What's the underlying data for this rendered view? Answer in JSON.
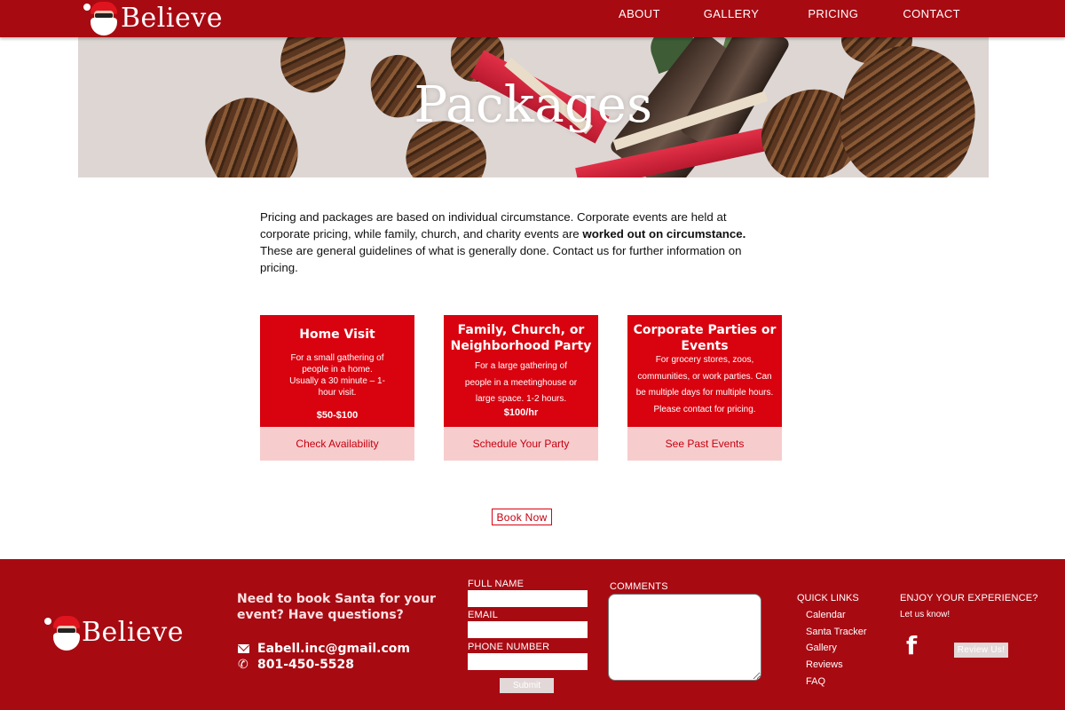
{
  "nav": {
    "brand": "Believe",
    "links": [
      "ABOUT",
      "GALLERY",
      "PRICING",
      "CONTACT"
    ]
  },
  "hero": {
    "title": "Packages"
  },
  "intro": {
    "part1": "Pricing and packages are based on individual circumstance. Corporate events are held at corporate pricing, while family, church, and charity events are ",
    "bold": "worked out on circumstance.",
    "part2": " These are general guidelines of what is generally done. Contact us for further information on pricing."
  },
  "cards": [
    {
      "title": "Home Visit",
      "description": "For a small gathering of people in a home. Usually a 30 minute – 1-hour visit.",
      "price": "$50-$100",
      "action": "Check Availability"
    },
    {
      "title": "Family, Church, or Neighborhood Party",
      "description": "For a large gathering of people in a meetinghouse or large space. 1-2 hours.",
      "price": "$100/hr",
      "action": "Schedule Your Party"
    },
    {
      "title": "Corporate Parties or Events",
      "description": "For grocery stores, zoos, communities, or work parties. Can be multiple days for multiple hours. Please contact for pricing.",
      "price": "",
      "action": "See Past Events"
    }
  ],
  "book_now": "Book Now",
  "footer": {
    "brand": "Believe",
    "question": "Need to book Santa for your event? Have questions?",
    "email": "Eabell.inc@gmail.com",
    "phone": "801-450-5528",
    "form": {
      "full_name_label": "FULL NAME",
      "email_label": "EMAIL",
      "phone_label": "PHONE NUMBER",
      "comments_label": "COMMENTS",
      "submit": "Submit"
    },
    "quick_links": {
      "heading": "QUICK LINKS",
      "items": [
        "Calendar",
        "Santa Tracker",
        "Gallery",
        "Reviews",
        "FAQ"
      ]
    },
    "enjoy": {
      "heading": "ENJOY YOUR EXPERIENCE?",
      "sub": "Let us know!",
      "facebook_icon": "f",
      "review_button": "Review Us!"
    }
  },
  "colors": {
    "brand_red": "#a80a12",
    "card_red": "#d9020f",
    "card_action_bg": "#f7cccd",
    "link_red": "#c5000f"
  }
}
